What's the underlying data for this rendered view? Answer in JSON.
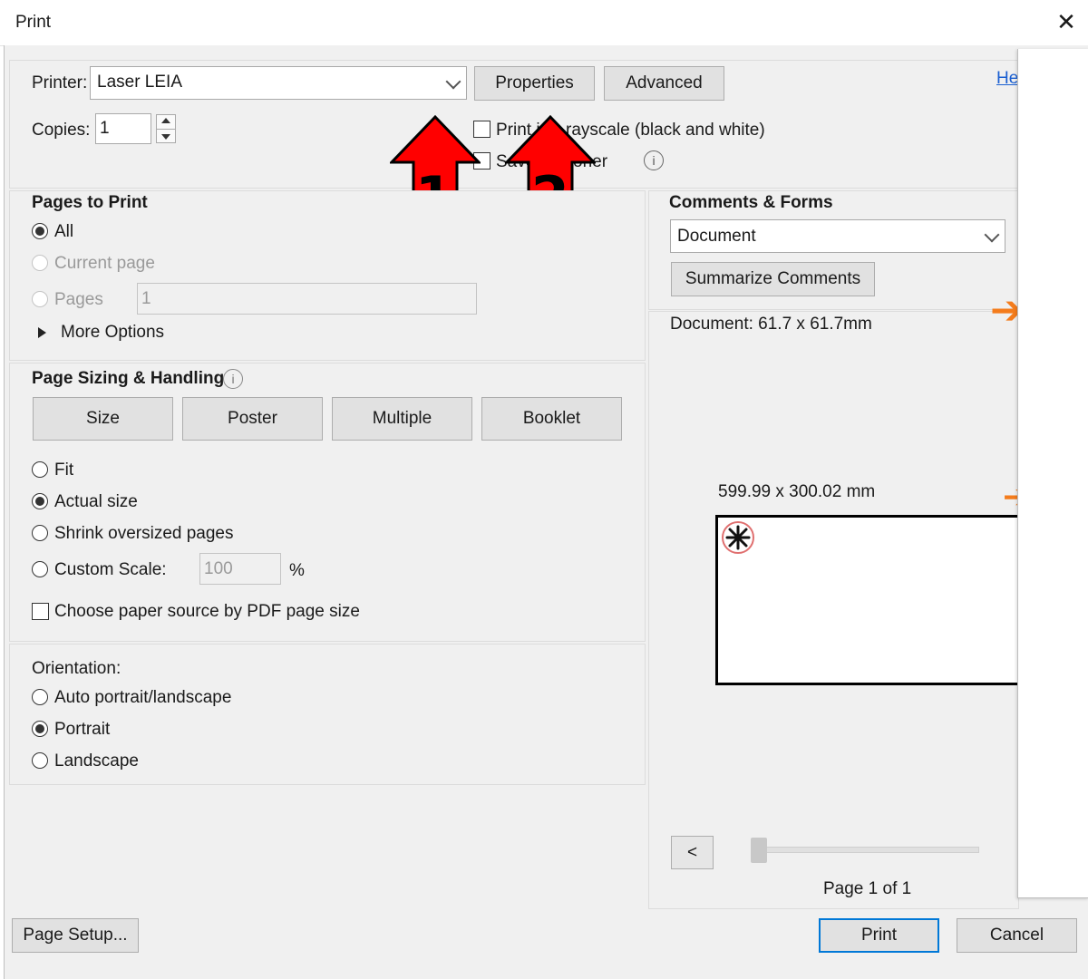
{
  "window": {
    "title": "Print",
    "close_glyph": "✕"
  },
  "printer": {
    "label": "Printer:",
    "value": "Laser LEIA",
    "properties_button": "Properties",
    "advanced_button": "Advanced",
    "help_link": "He"
  },
  "copies": {
    "label": "Copies:",
    "value": "1"
  },
  "options": {
    "grayscale_label": "Print in grayscale (black and white)",
    "grayscale_visible_a": "Print i",
    "grayscale_visible_b": "rayscale (black and white)",
    "save_ink_visible_a": "Save",
    "save_ink_visible_b": "oner",
    "info_glyph": "i"
  },
  "annotations": {
    "arrow1_label": "1",
    "arrow2_label": "2",
    "arrow_color": "#ff0000",
    "side_arrow_color": "#f47c1c",
    "side_arrow_glyph": "➔"
  },
  "pages_to_print": {
    "heading": "Pages to Print",
    "all": "All",
    "current_page": "Current page",
    "pages": "Pages",
    "pages_value": "1",
    "more_options": "More Options"
  },
  "page_sizing": {
    "heading": "Page Sizing & Handling",
    "tabs": [
      "Size",
      "Poster",
      "Multiple",
      "Booklet"
    ],
    "fit": "Fit",
    "actual_size": "Actual size",
    "shrink": "Shrink oversized pages",
    "custom_scale": "Custom Scale:",
    "custom_scale_value": "100",
    "percent": "%",
    "paper_source": "Choose paper source by PDF page size"
  },
  "orientation": {
    "label": "Orientation:",
    "auto": "Auto portrait/landscape",
    "portrait": "Portrait",
    "landscape": "Landscape"
  },
  "comments_forms": {
    "heading": "Comments & Forms",
    "selected": "Document",
    "summarize_button": "Summarize Comments"
  },
  "preview": {
    "document_size": "Document: 61.7 x 61.7mm",
    "page_size": "599.99 x 300.02 mm",
    "prev_button": "<",
    "page_indicator": "Page 1 of 1"
  },
  "footer": {
    "page_setup": "Page Setup...",
    "print": "Print",
    "cancel": "Cancel"
  }
}
